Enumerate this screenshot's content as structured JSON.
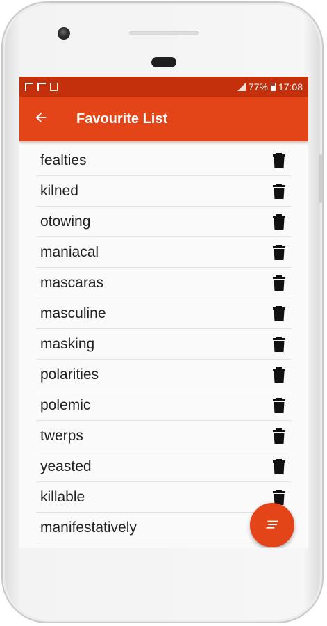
{
  "status_bar": {
    "battery": "77%",
    "time": "17:08"
  },
  "app_bar": {
    "title": "Favourite List",
    "back_icon": "arrow-left-icon"
  },
  "list": {
    "items": [
      {
        "word": "fealties"
      },
      {
        "word": "kilned"
      },
      {
        "word": "otowing"
      },
      {
        "word": "maniacal"
      },
      {
        "word": "mascaras"
      },
      {
        "word": "masculine"
      },
      {
        "word": "masking"
      },
      {
        "word": "polarities"
      },
      {
        "word": "polemic"
      },
      {
        "word": "twerps"
      },
      {
        "word": "yeasted"
      },
      {
        "word": "killable"
      },
      {
        "word": "manifestatively"
      }
    ],
    "row_action_icon": "trash-icon"
  },
  "fab": {
    "icon": "notes-icon"
  },
  "colors": {
    "status_bar": "#c4300c",
    "app_bar": "#e34418",
    "accent": "#e34418",
    "text": "#212121"
  }
}
